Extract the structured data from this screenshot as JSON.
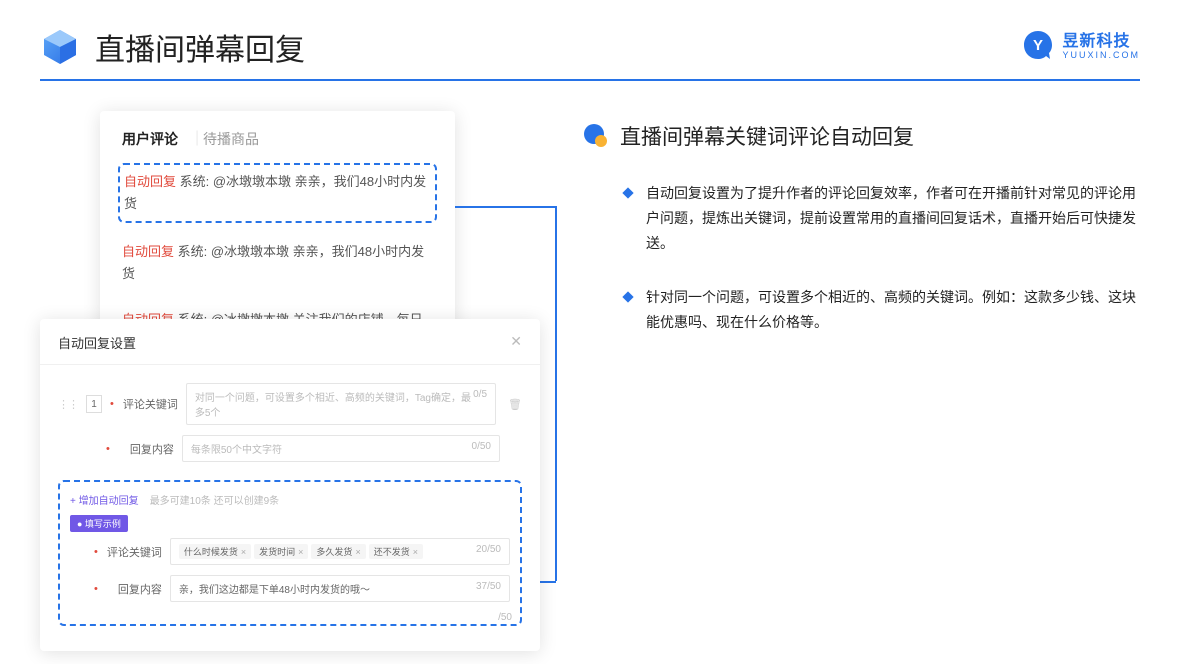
{
  "header": {
    "title": "直播间弹幕回复"
  },
  "brand": {
    "name": "昱新科技",
    "url": "YUUXIN.COM"
  },
  "panel1": {
    "tab_active": "用户评论",
    "tab_inactive": "待播商品",
    "msgs": [
      {
        "tag": "自动回复",
        "text": " 系统: @冰墩墩本墩 亲亲，我们48小时内发货"
      },
      {
        "tag": "自动回复",
        "text": " 系统: @冰墩墩本墩 亲亲，我们48小时内发货"
      },
      {
        "tag": "自动回复",
        "text": " 系统: @冰墩墩本墩 关注我们的店铺，每日都有热门推荐呦～"
      }
    ]
  },
  "panel2": {
    "title": "自动回复设置",
    "num": "1",
    "label_keyword": "评论关键词",
    "ph_keyword": "对同一个问题，可设置多个相近、高频的关键词，Tag确定，最多5个",
    "count_keyword": "0/5",
    "label_content": "回复内容",
    "ph_content": "每条限50个中文字符",
    "count_content": "0/50",
    "add_link": "+ 增加自动回复",
    "add_note": "最多可建10条 还可以创建9条",
    "example_badge": "● 填写示例",
    "ex_label_keyword": "评论关键词",
    "ex_tags": [
      "什么时候发货",
      "发货时间",
      "多久发货",
      "还不发货"
    ],
    "ex_count_keyword": "20/50",
    "ex_label_content": "回复内容",
    "ex_content_value": "亲，我们这边都是下单48小时内发货的哦～",
    "ex_count_content": "37/50",
    "stray_count": "/50"
  },
  "section": {
    "title": "直播间弹幕关键词评论自动回复",
    "bullets": [
      "自动回复设置为了提升作者的评论回复效率，作者可在开播前针对常见的评论用户问题，提炼出关键词，提前设置常用的直播间回复话术，直播开始后可快捷发送。",
      "针对同一个问题，可设置多个相近的、高频的关键词。例如：这款多少钱、这块能优惠吗、现在什么价格等。"
    ]
  }
}
